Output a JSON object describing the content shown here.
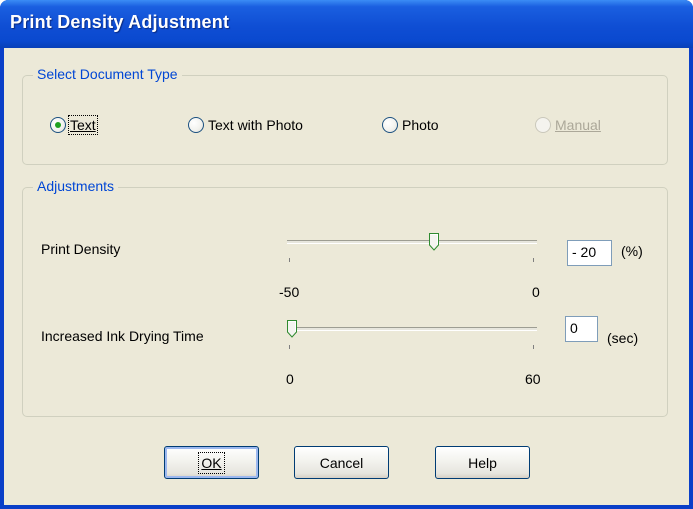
{
  "window": {
    "title": "Print Density Adjustment"
  },
  "document_type": {
    "group_label": "Select Document Type",
    "options": [
      {
        "label": "Text",
        "selected": true,
        "enabled": true
      },
      {
        "label": "Text with Photo",
        "selected": false,
        "enabled": true
      },
      {
        "label": "Photo",
        "selected": false,
        "enabled": true
      },
      {
        "label": "Manual",
        "selected": false,
        "enabled": false
      }
    ]
  },
  "adjustments": {
    "group_label": "Adjustments",
    "print_density": {
      "label": "Print Density",
      "value": "- 20",
      "unit": "(%)",
      "min_label": "-50",
      "max_label": "0",
      "min": -50,
      "max": 0,
      "current": -20
    },
    "drying_time": {
      "label": "Increased Ink Drying Time",
      "value": "0",
      "unit": "(sec)",
      "min_label": "0",
      "max_label": "60",
      "min": 0,
      "max": 60,
      "current": 0
    }
  },
  "buttons": {
    "ok": "OK",
    "cancel": "Cancel",
    "help": "Help"
  },
  "colors": {
    "titlebar": "#0a49cf",
    "dialog_bg": "#ece9d8",
    "group_label": "#0046d5",
    "radio_dot": "#21a121",
    "disabled_text": "#aca899"
  }
}
